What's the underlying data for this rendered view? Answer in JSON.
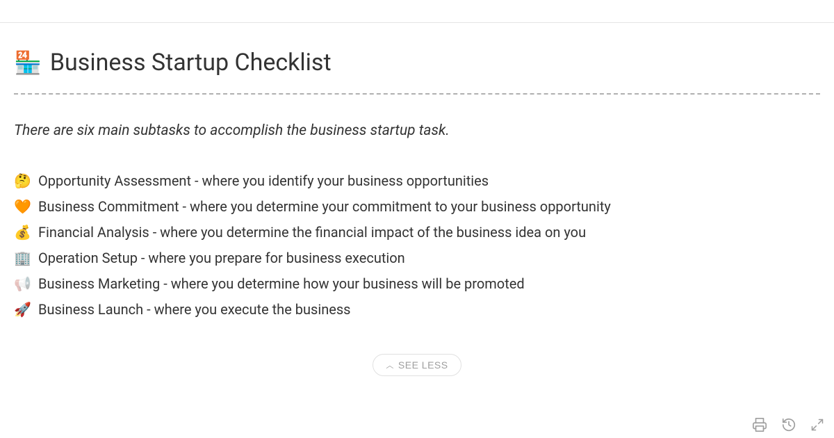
{
  "header": {
    "icon": "🏪",
    "title": "Business Startup Checklist"
  },
  "subtitle": "There are six main subtasks to accomplish the business startup task.",
  "items": [
    {
      "icon": "🤔",
      "text": "Opportunity Assessment - where you identify your business opportunities"
    },
    {
      "icon": "🧡",
      "text": "Business Commitment - where you determine your commitment to your business opportunity"
    },
    {
      "icon": "💰",
      "text": "Financial Analysis - where you determine the financial impact of the business idea on you"
    },
    {
      "icon": "🏢",
      "text": "Operation Setup - where you prepare for business execution"
    },
    {
      "icon": "📢",
      "text": "Business Marketing - where you determine how your business will be promoted"
    },
    {
      "icon": "🚀",
      "text": "Business Launch - where you execute the business"
    }
  ],
  "toggle": {
    "label": "SEE LESS"
  }
}
